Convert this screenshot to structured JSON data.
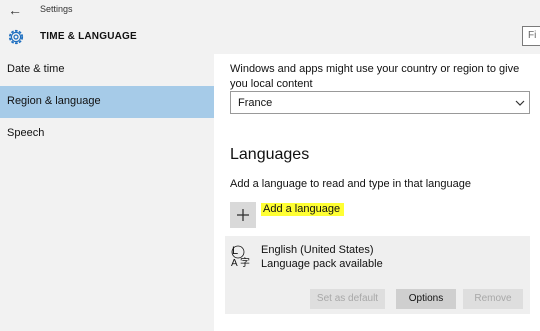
{
  "window": {
    "title": "Settings",
    "back_icon": "back-arrow-icon"
  },
  "header": {
    "title": "TIME & LANGUAGE",
    "icon": "gear-icon",
    "search_placeholder": "Fi"
  },
  "sidebar": {
    "items": [
      {
        "label": "Date & time",
        "active": false
      },
      {
        "label": "Region & language",
        "active": true
      },
      {
        "label": "Speech",
        "active": false
      }
    ]
  },
  "region": {
    "description": "Windows and apps might use your country or region to give you local content",
    "country_value": "France"
  },
  "languages": {
    "title": "Languages",
    "description": "Add a language to read and type in that language",
    "add_label": "Add a language",
    "highlight_color": "#ffff33",
    "items": [
      {
        "name": "English (United States)",
        "status": "Language pack available",
        "buttons": {
          "set_default": "Set as default",
          "options": "Options",
          "remove": "Remove"
        }
      }
    ]
  },
  "colors": {
    "sidebar_active": "#a6cbe8",
    "chrome_bg": "#f2f2f2"
  }
}
